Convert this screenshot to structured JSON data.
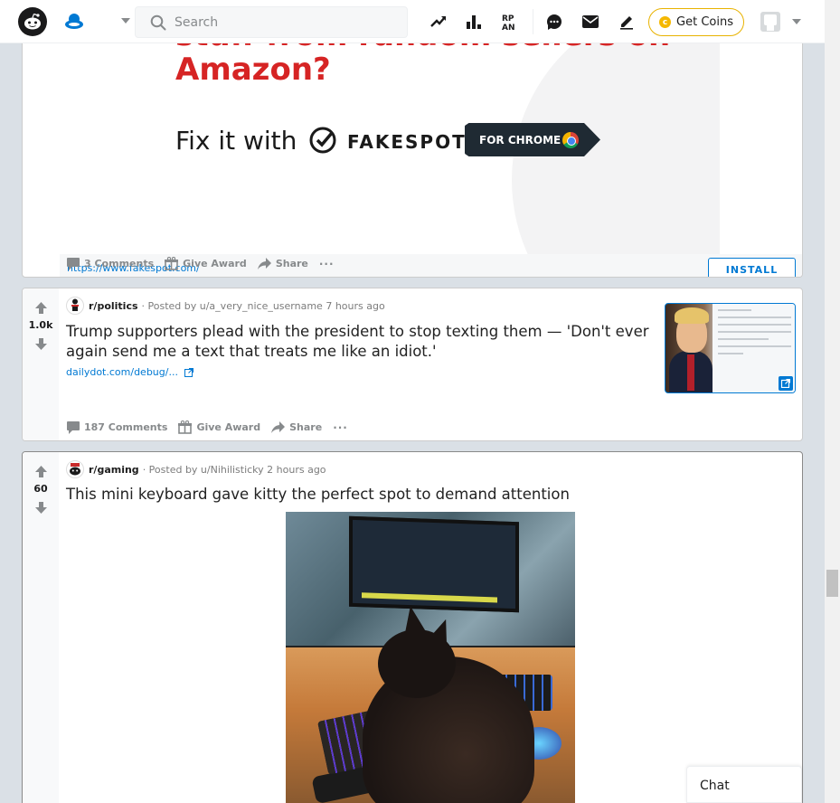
{
  "header": {
    "search_placeholder": "Search",
    "get_coins": "Get Coins",
    "coin_symbol": "c"
  },
  "ad_post": {
    "headline_partial": "stuff from random sellers on",
    "headline": "Amazon?",
    "fix_text": "Fix it with",
    "brand": "FAKESPOT",
    "cta": "FOR CHROME",
    "link": "https://www.fakespot.com/",
    "install": "INSTALL",
    "comments": "3 Comments",
    "give_award": "Give Award",
    "share": "Share",
    "more": "···"
  },
  "politics_post": {
    "score": "1.0k",
    "subreddit": "r/politics",
    "posted_by": "· Posted by u/a_very_nice_username 7 hours ago",
    "title": "Trump supporters plead with the president to stop texting them — 'Don't ever again send me a text that treats me like an idiot.'",
    "link": "dailydot.com/debug/...",
    "comments": "187 Comments",
    "give_award": "Give Award",
    "share": "Share",
    "more": "···"
  },
  "gaming_post": {
    "score": "60",
    "subreddit": "r/gaming",
    "posted_by": "· Posted by u/Nihilisticky 2 hours ago",
    "title": "This mini keyboard gave kitty the perfect spot to demand attention"
  },
  "chat": "Chat",
  "colors": {
    "accent": "#0079d3",
    "ad_red": "#d62424",
    "coin_border": "#e8b200"
  }
}
